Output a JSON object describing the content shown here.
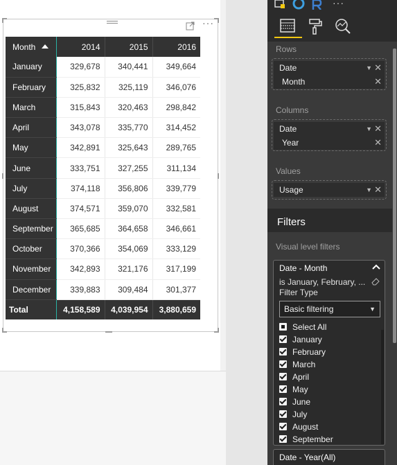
{
  "matrix": {
    "header_month": "Month",
    "years": [
      "2014",
      "2015",
      "2016"
    ],
    "rows": [
      {
        "month": "January",
        "values": [
          "329,678",
          "340,441",
          "349,664"
        ]
      },
      {
        "month": "February",
        "values": [
          "325,832",
          "325,119",
          "346,076"
        ]
      },
      {
        "month": "March",
        "values": [
          "315,843",
          "320,463",
          "298,842"
        ]
      },
      {
        "month": "April",
        "values": [
          "343,078",
          "335,770",
          "314,452"
        ]
      },
      {
        "month": "May",
        "values": [
          "342,891",
          "325,643",
          "289,765"
        ]
      },
      {
        "month": "June",
        "values": [
          "333,751",
          "327,255",
          "311,134"
        ]
      },
      {
        "month": "July",
        "values": [
          "374,118",
          "356,806",
          "339,779"
        ]
      },
      {
        "month": "August",
        "values": [
          "374,571",
          "359,070",
          "332,581"
        ]
      },
      {
        "month": "September",
        "values": [
          "365,685",
          "364,658",
          "346,661"
        ]
      },
      {
        "month": "October",
        "values": [
          "370,366",
          "354,069",
          "333,129"
        ]
      },
      {
        "month": "November",
        "values": [
          "342,893",
          "321,176",
          "317,199"
        ]
      },
      {
        "month": "December",
        "values": [
          "339,883",
          "309,484",
          "301,377"
        ]
      }
    ],
    "total": {
      "label": "Total",
      "values": [
        "4,158,589",
        "4,039,954",
        "3,880,659"
      ]
    }
  },
  "pane": {
    "rows_label": "Rows",
    "rows_fields": [
      "Date",
      "Month"
    ],
    "columns_label": "Columns",
    "columns_fields": [
      "Date",
      "Year"
    ],
    "values_label": "Values",
    "values_fields": [
      "Usage"
    ],
    "filters_title": "Filters",
    "visual_filters_label": "Visual level filters",
    "filter_card": {
      "title": "Date - Month",
      "summary": "is January, February, ...",
      "type_label": "Filter Type",
      "type_value": "Basic filtering",
      "items": [
        "Select All",
        "January",
        "February",
        "March",
        "April",
        "May",
        "June",
        "July",
        "August",
        "September"
      ]
    },
    "filter_card_2": "Date - Year(All)"
  },
  "colors": {
    "accent": "#f2c811",
    "matrix_header": "#333333",
    "teal_divider": "#2ab3a6",
    "pane_bg": "#3a3a3a"
  }
}
